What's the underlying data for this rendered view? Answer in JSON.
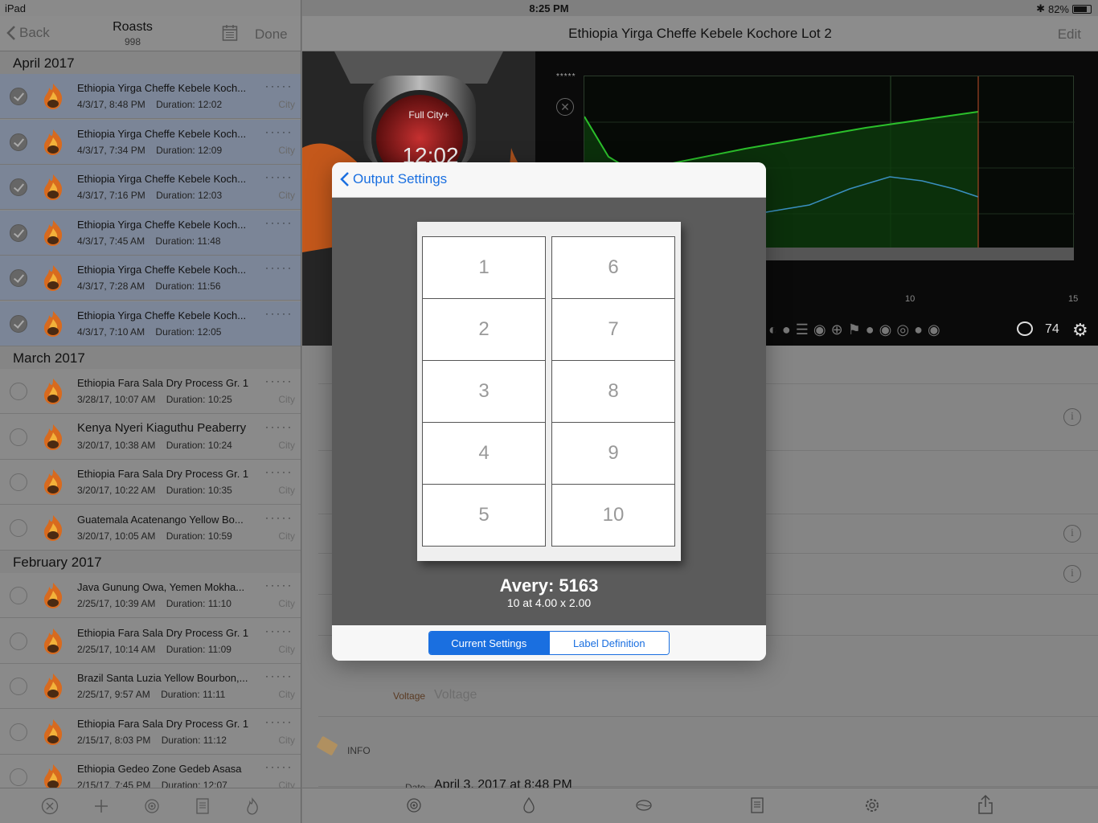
{
  "status": {
    "carrier": "iPad",
    "time": "8:25 PM",
    "battery": "82%",
    "battery_level": 0.82
  },
  "sidebar": {
    "back_label": "Back",
    "title": "Roasts",
    "subtitle": "998",
    "done_label": "Done",
    "sections": [
      {
        "header": "April 2017",
        "rows": [
          {
            "name": "Ethiopia Yirga Cheffe Kebele Koch...",
            "date": "4/3/17, 8:48 PM",
            "duration": "Duration: 12:02",
            "level": "City",
            "selected": true
          },
          {
            "name": "Ethiopia Yirga Cheffe Kebele Koch...",
            "date": "4/3/17, 7:34 PM",
            "duration": "Duration: 12:09",
            "level": "City",
            "selected": true
          },
          {
            "name": "Ethiopia Yirga Cheffe Kebele Koch...",
            "date": "4/3/17, 7:16 PM",
            "duration": "Duration: 12:03",
            "level": "City",
            "selected": true
          },
          {
            "name": "Ethiopia Yirga Cheffe Kebele Koch...",
            "date": "4/3/17, 7:45 AM",
            "duration": "Duration: 11:48",
            "level": "",
            "selected": true
          },
          {
            "name": "Ethiopia Yirga Cheffe Kebele Koch...",
            "date": "4/3/17, 7:28 AM",
            "duration": "Duration: 11:56",
            "level": "",
            "selected": true
          },
          {
            "name": "Ethiopia Yirga Cheffe Kebele Koch...",
            "date": "4/3/17, 7:10 AM",
            "duration": "Duration: 12:05",
            "level": "",
            "selected": true
          }
        ]
      },
      {
        "header": "March 2017",
        "rows": [
          {
            "name": "Ethiopia Fara Sala Dry Process Gr. 1",
            "date": "3/28/17, 10:07 AM",
            "duration": "Duration: 10:25",
            "level": "City",
            "selected": false
          },
          {
            "name": "Kenya Nyeri Kiaguthu Peaberry",
            "date": "3/20/17, 10:38 AM",
            "duration": "Duration: 10:24",
            "level": "City",
            "selected": false,
            "big": true
          },
          {
            "name": "Ethiopia Fara Sala Dry Process Gr. 1",
            "date": "3/20/17, 10:22 AM",
            "duration": "Duration: 10:35",
            "level": "City",
            "selected": false
          },
          {
            "name": "Guatemala Acatenango Yellow Bo...",
            "date": "3/20/17, 10:05 AM",
            "duration": "Duration: 10:59",
            "level": "City",
            "selected": false
          }
        ]
      },
      {
        "header": "February 2017",
        "rows": [
          {
            "name": "Java Gunung Owa, Yemen Mokha...",
            "date": "2/25/17, 10:39 AM",
            "duration": "Duration: 11:10",
            "level": "City",
            "selected": false
          },
          {
            "name": "Ethiopia Fara Sala Dry Process Gr. 1",
            "date": "2/25/17, 10:14 AM",
            "duration": "Duration: 11:09",
            "level": "City",
            "selected": false
          },
          {
            "name": "Brazil Santa Luzia Yellow Bourbon,...",
            "date": "2/25/17, 9:57 AM",
            "duration": "Duration: 11:11",
            "level": "City",
            "selected": false
          },
          {
            "name": "Ethiopia Fara Sala Dry Process Gr. 1",
            "date": "2/15/17, 8:03 PM",
            "duration": "Duration: 11:12",
            "level": "City",
            "selected": false
          },
          {
            "name": "Ethiopia Gedeo Zone Gedeb Asasa",
            "date": "2/15/17, 7:45 PM",
            "duration": "Duration: 12:07",
            "level": "City",
            "selected": false
          }
        ]
      }
    ],
    "toolbar_icons": [
      "cancel-icon",
      "add-icon",
      "target-icon",
      "notes-icon",
      "flame-icon"
    ]
  },
  "detail": {
    "title": "Ethiopia Yirga Cheffe Kebele Kochore Lot 2",
    "edit_label": "Edit",
    "gauge_label": "Full City+",
    "gauge_time": "12:02",
    "rating_dots": "*****",
    "timeline_ticks": [
      "10",
      "15"
    ],
    "roast_count": "74",
    "voltage_label": "Voltage",
    "voltage_placeholder": "Voltage",
    "info_header": "INFO",
    "date_label": "Date",
    "date_value": "April 3, 2017 at 8:48 PM"
  },
  "modal": {
    "back_label": "Output Settings",
    "labels": [
      "1",
      "2",
      "3",
      "4",
      "5",
      "6",
      "7",
      "8",
      "9",
      "10"
    ],
    "label_name": "Avery: 5163",
    "label_size": "10 at 4.00 x 2.00",
    "segments": [
      {
        "label": "Current Settings",
        "active": true
      },
      {
        "label": "Label Definition",
        "active": false
      }
    ]
  },
  "colors": {
    "accent": "#1a6fe0",
    "chart_line": "#2bbf2b",
    "chart_secondary": "#3a8fc0"
  }
}
